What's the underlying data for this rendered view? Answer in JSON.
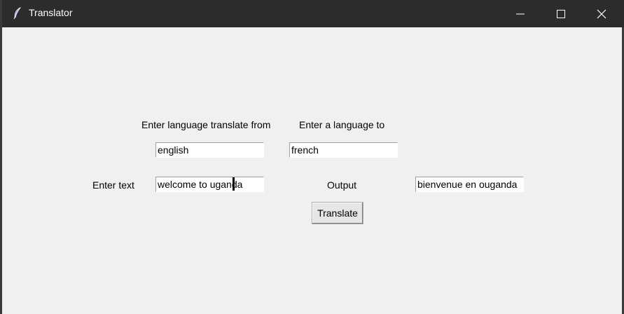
{
  "window": {
    "title": "Translator",
    "icons": {
      "app": "feather-icon",
      "minimize": "minimize-icon",
      "maximize": "maximize-icon",
      "close": "close-icon"
    },
    "colors": {
      "titlebar": "#2c2c2c",
      "background": "#f0f0f0"
    }
  },
  "form": {
    "from_label": "Enter language translate from",
    "to_label": "Enter a language to",
    "from_value": "english",
    "to_value": "french",
    "text_label": "Enter text",
    "text_value": "welcome to uganda",
    "output_label": "Output",
    "output_value": "bienvenue en ouganda",
    "translate_button": "Translate"
  }
}
